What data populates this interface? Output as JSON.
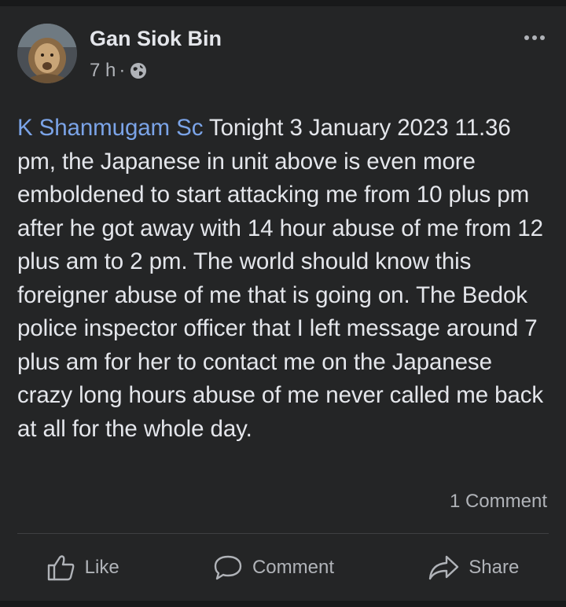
{
  "post": {
    "author_name": "Gan Siok Bin",
    "time": "7 h",
    "separator": "·",
    "visibility_icon": "globe-icon",
    "more_icon": "more-options-icon",
    "mention": "K Shanmugam Sc",
    "text": " Tonight 3 January 2023 11.36 pm, the Japanese in unit above is even more emboldened to start attacking me from 10 plus pm after he got away with 14 hour abuse of me from 12 plus am to 2 pm. The world should know this foreigner abuse of me that is going on. The Bedok police inspector officer that I left message around 7 plus am for her to contact me on the Japanese crazy long hours abuse of me never called me back at all for the whole day.",
    "comments_count": "1 Comment"
  },
  "actions": {
    "like_label": "Like",
    "comment_label": "Comment",
    "share_label": "Share",
    "like_icon": "thumbs-up-icon",
    "comment_icon": "speech-bubble-icon",
    "share_icon": "share-arrow-icon"
  },
  "colors": {
    "background": "#242526",
    "page": "#18191a",
    "text": "#e4e6eb",
    "secondary": "#b0b3b8",
    "mention": "#7ba4e8"
  }
}
